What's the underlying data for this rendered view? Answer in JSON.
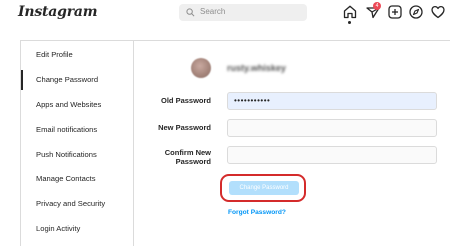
{
  "app": {
    "logo_text": "Instagram"
  },
  "search": {
    "placeholder": "Search"
  },
  "nav": {
    "icons": [
      "home-icon",
      "activity-icon",
      "new-post-icon",
      "explore-icon",
      "heart-icon"
    ],
    "notification_count": "4"
  },
  "sidebar": {
    "items": [
      {
        "label": "Edit Profile",
        "active": false
      },
      {
        "label": "Change Password",
        "active": true
      },
      {
        "label": "Apps and Websites",
        "active": false
      },
      {
        "label": "Email notifications",
        "active": false
      },
      {
        "label": "Push Notifications",
        "active": false
      },
      {
        "label": "Manage Contacts",
        "active": false
      },
      {
        "label": "Privacy and Security",
        "active": false
      },
      {
        "label": "Login Activity",
        "active": false
      }
    ]
  },
  "profile": {
    "username": "rusty.whiskey"
  },
  "form": {
    "old_password_label": "Old Password",
    "old_password_value": "•••••••••••",
    "new_password_label": "New Password",
    "new_password_value": "",
    "confirm_label_line1": "Confirm New",
    "confirm_label_line2": "Password",
    "confirm_password_value": "",
    "submit_label": "Change Password",
    "forgot_label": "Forgot Password?"
  },
  "colors": {
    "accent": "#0095f6",
    "button_disabled": "#b2dffc",
    "highlight": "#d42b2b",
    "badge": "#ed4956",
    "autofill": "#e8f0fe"
  }
}
